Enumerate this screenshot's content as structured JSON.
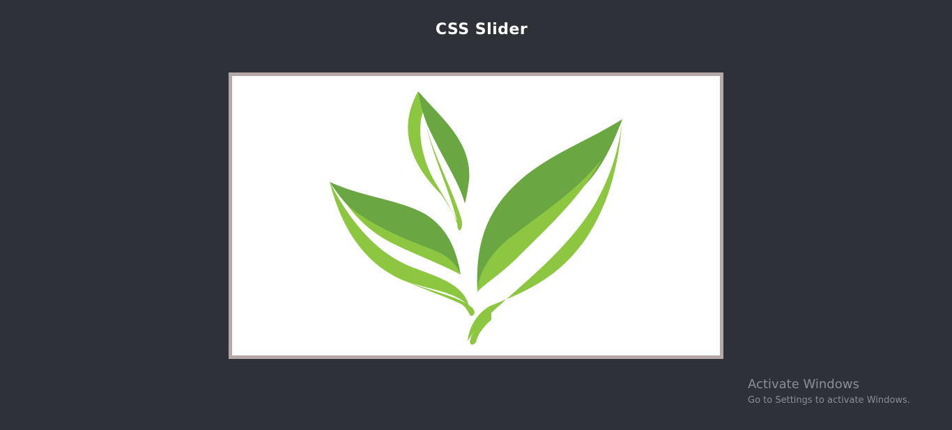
{
  "page": {
    "title": "CSS Slider"
  },
  "slider": {
    "slides": [
      {
        "image": "green-leaves-logo"
      }
    ]
  },
  "watermark": {
    "title": "Activate Windows",
    "subtitle": "Go to Settings to activate Windows."
  },
  "colors": {
    "background": "#2e3137",
    "frame_border": "#b5a8a8",
    "leaf_dark": "#6aa743",
    "leaf_light": "#8dc641"
  }
}
